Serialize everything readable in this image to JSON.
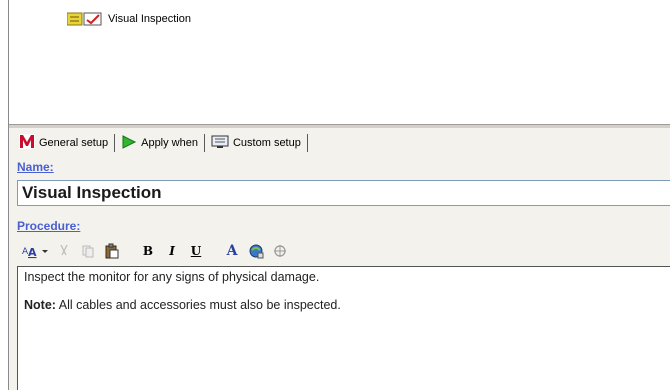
{
  "tree": {
    "items": [
      {
        "label": "Visual Inspection",
        "icon": "checklist-icon"
      }
    ]
  },
  "tabs": [
    {
      "label": "General setup",
      "icon": "m-logo-icon",
      "active": true
    },
    {
      "label": "Apply when",
      "icon": "play-arrow-icon",
      "active": false
    },
    {
      "label": "Custom setup",
      "icon": "monitor-icon",
      "active": false
    }
  ],
  "name_field": {
    "label": "Name:",
    "value": "Visual Inspection"
  },
  "procedure_field": {
    "label": "Procedure:"
  },
  "toolbar": {
    "bold_label": "B",
    "italic_label": "I",
    "underline_label": "U",
    "font_color_label": "A"
  },
  "procedure_text": {
    "line1": "Inspect the monitor for any signs of physical damage.",
    "note_label": "Note:",
    "note_text": " All cables and accessories must also be inspected."
  },
  "colors": {
    "label_blue": "#4a5fd0",
    "panel_bg": "#f3f2ec",
    "input_border": "#7f9db9"
  }
}
